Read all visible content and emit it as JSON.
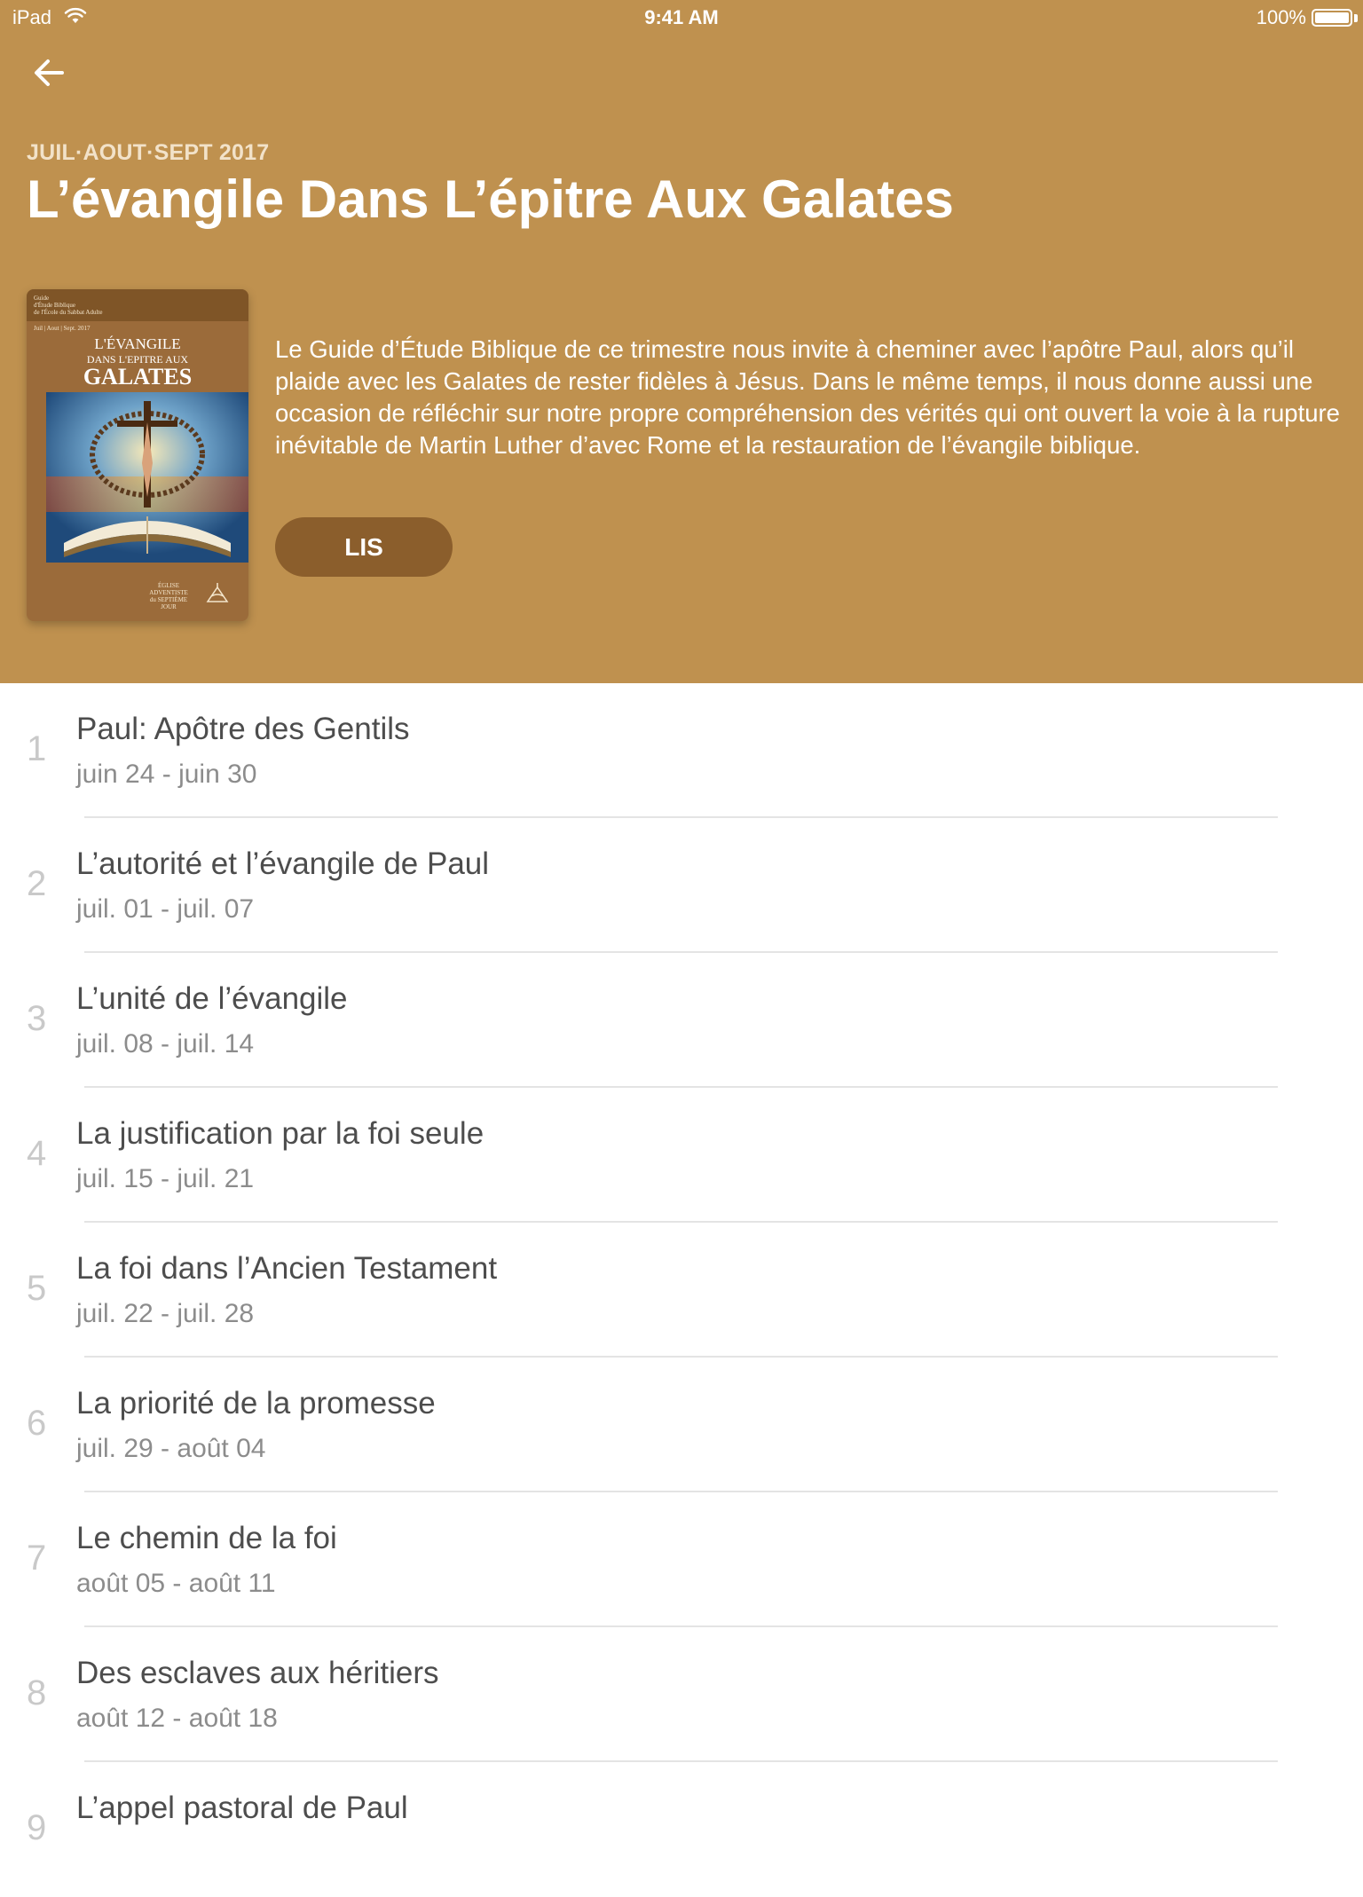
{
  "status_bar": {
    "device": "iPad",
    "time": "9:41 AM",
    "battery": "100%"
  },
  "header": {
    "quarter": "JUIL·AOUT·SEPT 2017",
    "title": "L’évangile Dans L’épitre Aux Galates",
    "description": "Le Guide d’Étude Biblique de ce trimestre nous invite à cheminer avec l’apôtre Paul, alors qu’il plaide avec les Galates de rester fidèles à Jésus. Dans le même temps, il nous donne aussi une occasion de réfléchir sur notre propre compréhension des vérités qui ont ouvert la voie à la rupture inévitable de Martin Luther d’avec Rome et la restauration de l’évangile biblique.",
    "read_label": "LIS",
    "background_color": "#BF914F",
    "button_color": "#8B5E2C"
  },
  "cover": {
    "small_1": "Guide",
    "small_2": "d'Étude Biblique",
    "small_3": "de l'École du Sabbat Adulte",
    "small_4": "Juil | Aout | Sept. 2017",
    "title_1": "L'ÉVANGILE",
    "title_2": "DANS L'EPITRE AUX",
    "title_3": "GALATES",
    "publisher_1": "ÉGLISE",
    "publisher_2": "ADVENTISTE",
    "publisher_3": "du SEPTIÈME JOUR"
  },
  "lessons": [
    {
      "number": "1",
      "title": "Paul: Apôtre des Gentils",
      "dates": "juin 24 - juin 30"
    },
    {
      "number": "2",
      "title": "L’autorité et l’évangile de Paul",
      "dates": "juil. 01 - juil. 07"
    },
    {
      "number": "3",
      "title": "L’unité de l’évangile",
      "dates": "juil. 08 - juil. 14"
    },
    {
      "number": "4",
      "title": "La justification par la foi seule",
      "dates": "juil. 15 - juil. 21"
    },
    {
      "number": "5",
      "title": "La foi dans l’Ancien Testament",
      "dates": "juil. 22 - juil. 28"
    },
    {
      "number": "6",
      "title": "La priorité de la promesse",
      "dates": "juil. 29 - août 04"
    },
    {
      "number": "7",
      "title": "Le chemin de la foi",
      "dates": "août 05 - août 11"
    },
    {
      "number": "8",
      "title": "Des esclaves aux héritiers",
      "dates": "août 12 - août 18"
    },
    {
      "number": "9",
      "title": "L’appel pastoral de Paul",
      "dates": ""
    }
  ]
}
